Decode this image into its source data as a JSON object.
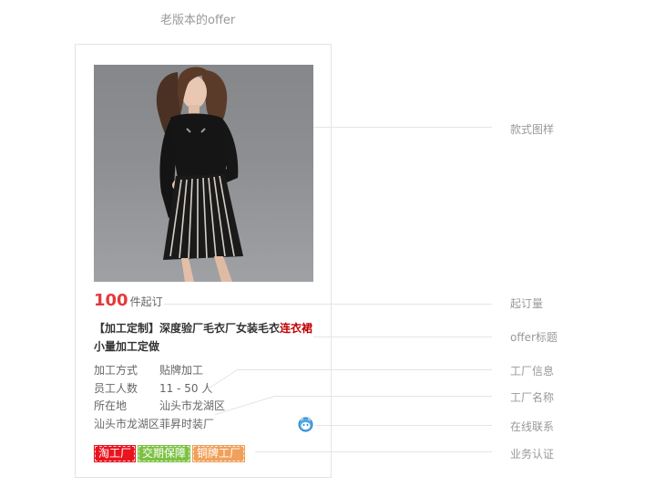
{
  "page": {
    "title": "老版本的offer"
  },
  "offer": {
    "price": {
      "amount": "100",
      "unit": "件起订"
    },
    "title": {
      "prefix": "【加工定制】深度验厂毛衣厂女装毛衣",
      "highlight": "连衣裙",
      "suffix": "小量加工定做"
    },
    "info": [
      {
        "key": "加工方式",
        "value": "贴牌加工"
      },
      {
        "key": "员工人数",
        "value": "11 - 50 人"
      },
      {
        "key": "所在地",
        "value": "汕头市龙湖区"
      }
    ],
    "factory_name": "汕头市龙湖区菲昇时装厂",
    "badges": [
      {
        "label": "淘工厂",
        "color": "#e8141f"
      },
      {
        "label": "交期保障",
        "color": "#7cc142"
      },
      {
        "label": "铜牌工厂",
        "color": "#f0a05a"
      }
    ],
    "chat_icon": "wangwang-chat-icon"
  },
  "annotations": {
    "style_image": "款式图样",
    "moq": "起订量",
    "offer_title": "offer标题",
    "factory_info": "工厂信息",
    "factory_name": "工厂名称",
    "online_contact": "在线联系",
    "business_cert": "业务认证"
  }
}
